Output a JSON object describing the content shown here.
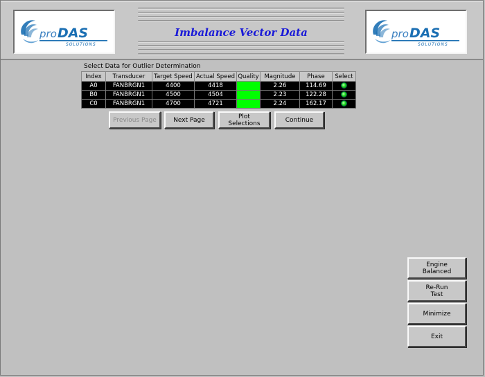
{
  "header": {
    "title": "Imbalance Vector Data",
    "logo_left": "proDAS SOLUTIONS",
    "logo_right": "proDAS SOLUTIONS"
  },
  "table": {
    "caption": "Select Data for Outlier Determination",
    "columns": [
      "Index",
      "Transducer",
      "Target Speed",
      "Actual Speed",
      "Quality",
      "Magnitude",
      "Phase",
      "Select"
    ],
    "rows": [
      {
        "index": "A0",
        "transducer": "FANBRGN1",
        "target_speed": "4400",
        "actual_speed": "4418",
        "quality": "",
        "magnitude": "2.26",
        "phase": "114.69"
      },
      {
        "index": "B0",
        "transducer": "FANBRGN1",
        "target_speed": "4500",
        "actual_speed": "4504",
        "quality": "",
        "magnitude": "2.23",
        "phase": "122.28"
      },
      {
        "index": "C0",
        "transducer": "FANBRGN1",
        "target_speed": "4700",
        "actual_speed": "4721",
        "quality": "",
        "magnitude": "2.24",
        "phase": "162.17"
      }
    ],
    "quality_color": "#00ff00",
    "select_color": "#22dd22"
  },
  "buttons": {
    "previous_page": "Previous Page",
    "next_page": "Next Page",
    "plot_selections": "Plot\nSelections",
    "continue": "Continue",
    "engine_balanced": "Engine\nBalanced",
    "rerun_test": "Re-Run\nTest",
    "minimize": "Minimize",
    "exit": "Exit"
  },
  "colors": {
    "background": "#c0c0c0",
    "title": "#1a1ad8",
    "logo_blue": "#1b6fb3"
  }
}
